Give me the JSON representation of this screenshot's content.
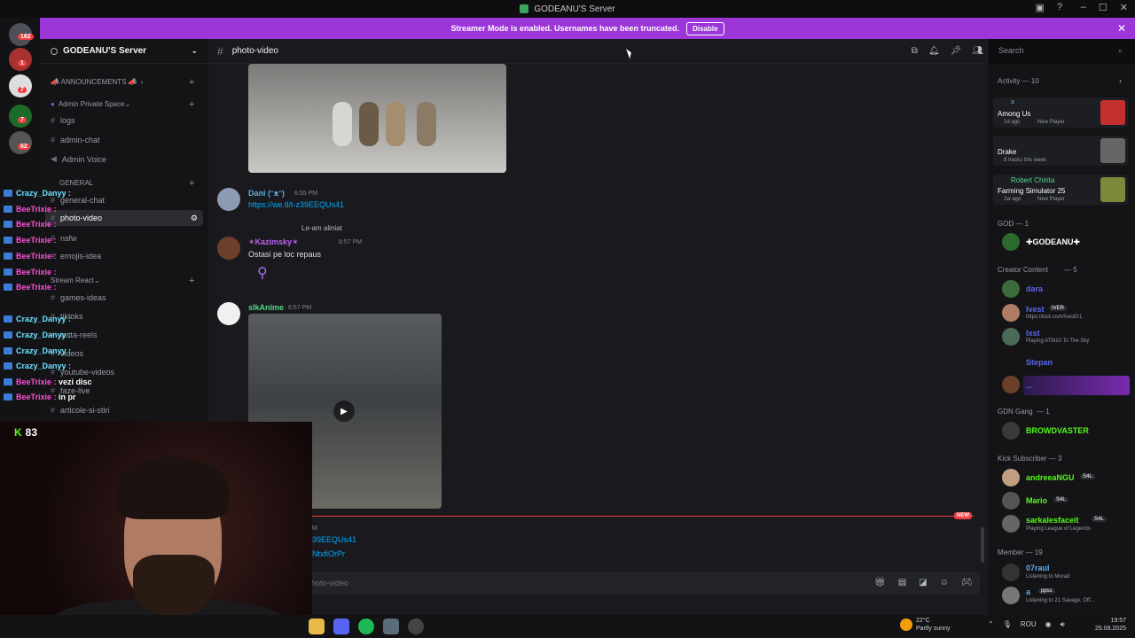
{
  "window": {
    "title": "GODEANU'S Server"
  },
  "banner": {
    "text": "Streamer Mode is enabled. Usernames have been truncated.",
    "disable_label": "Disable"
  },
  "server": {
    "name": "GODEANU'S Server",
    "badges": [
      "162",
      "1",
      "7",
      "7",
      "62"
    ]
  },
  "channels": {
    "announcements": "📣 ANNOUNCEMENTS 📣",
    "admin_space": "Admin Private Space",
    "logs": "logs",
    "admin_chat": "admin-chat",
    "admin_voice": "Admin Voice",
    "general_cat": "GENERAL",
    "general_chat": "general-chat",
    "photo_video": "photo-video",
    "nsfw": "nsfw",
    "emojis": "emojis-idea",
    "stream_cat": "Stream React",
    "games_ideas": "games-ideas",
    "tiktoks": "tiktoks",
    "insta": "insta-reels",
    "videos": "videos",
    "youtube": "youtube-videos",
    "faze": "faze-live",
    "articole": "articole-si-stiri"
  },
  "main": {
    "channel": "photo-video",
    "messages": [
      {
        "user": "Dani (ᵔᴥᵔ)",
        "time": "6:55 PM",
        "link": "https://we.tl/t-z39EEQUs41"
      },
      {
        "reply_text": "Le-am aliniat",
        "user": "✶Kazimsky✶",
        "time": "6:57 PM",
        "text": "Ostasi pe loc repaus"
      },
      {
        "user": "slkAnime",
        "time": "6:57 PM"
      }
    ],
    "partial_link_1": "39EEQUs41",
    "partial_link_2": "NtxfiOrPr",
    "partial_time": "M",
    "new_label": "NEW",
    "composer_placeholder": "hoto-video",
    "search_placeholder": "Search"
  },
  "members": {
    "activity_header": "Activity — 10",
    "activities": [
      {
        "name": "a",
        "title": "Among Us",
        "sub": "1d ago",
        "tag": "New Player"
      },
      {
        "name": "",
        "title": "Drake",
        "sub": "8 tracks this week",
        "tag": ""
      },
      {
        "name": "Robert Chirita",
        "title": "Farming Simulator 25",
        "sub": "2w ago",
        "tag": "New Player"
      }
    ],
    "god_header": "GOD — 1",
    "god_name": "✚GODEANU✚",
    "creator_header": "Creator Content",
    "creator_count": "— 5",
    "creators": [
      {
        "name": "dara",
        "sub": ""
      },
      {
        "name": "Ivest",
        "tag": "IVER",
        "sub": "https://kick.com/IvesEr1"
      },
      {
        "name": "Ixst",
        "sub": "Playing ATM10 To The Sky"
      },
      {
        "name": "Stepan",
        "sub": ""
      },
      {
        "name": "...",
        "sub": ""
      }
    ],
    "gdn_header": "GDN Gang",
    "gdn_count": "— 1",
    "gdn_name": "BROWDVASTER",
    "kick_header": "Kick Subscriber — 3",
    "kick_subs": [
      {
        "name": "andreeaNGU",
        "tag": "S4L",
        "sub": ""
      },
      {
        "name": "Mario",
        "tag": "S4L",
        "sub": ""
      },
      {
        "name": "sarkalesfaceit",
        "tag": "S4L",
        "sub": "Playing League of Legends"
      }
    ],
    "member_header": "Member — 19",
    "plain_members": [
      {
        "name": "07raul",
        "sub": "Listening to Morad"
      },
      {
        "name": "a",
        "tag": "ppsc",
        "sub": "Listening to 21 Savage, Off..."
      }
    ]
  },
  "stream_chat": [
    {
      "user": "Crazy_Danyy :",
      "color": "#6fe0ff"
    },
    {
      "user": "BeeTrixie :",
      "color": "#ff4fd8"
    },
    {
      "user": "BeeTrixie :",
      "color": "#ff4fd8"
    },
    {
      "user": "BeeTrixie :",
      "color": "#ff4fd8"
    },
    {
      "user": "BeeTrixie :",
      "color": "#ff4fd8"
    },
    {
      "user": "BeeTrixie :",
      "color": "#ff4fd8"
    },
    {
      "user": "BeeTrixie :",
      "color": "#ff4fd8"
    },
    {
      "user": "Crazy_Danyy :",
      "color": "#6fe0ff"
    },
    {
      "user": "Crazy_Danyy :",
      "color": "#6fe0ff"
    },
    {
      "user": "Crazy_Danyy :",
      "color": "#6fe0ff"
    },
    {
      "user": "Crazy_Danyy :",
      "color": "#6fe0ff"
    },
    {
      "user": "BeeTrixie :",
      "color": "#ff4fd8",
      "msg": "vezi disc"
    },
    {
      "user": "BeeTrixie :",
      "color": "#ff4fd8",
      "msg": "in pr"
    }
  ],
  "kick_viewers": "83",
  "taskbar": {
    "temp": "22°C",
    "weather": "Partly sunny",
    "lang": "ROU",
    "time": "19:57",
    "date": "25.08.2025"
  },
  "colors": {
    "accent": "#9c36d8",
    "link": "#00a8fc",
    "new": "#f23f42",
    "kick": "#53fc18"
  }
}
